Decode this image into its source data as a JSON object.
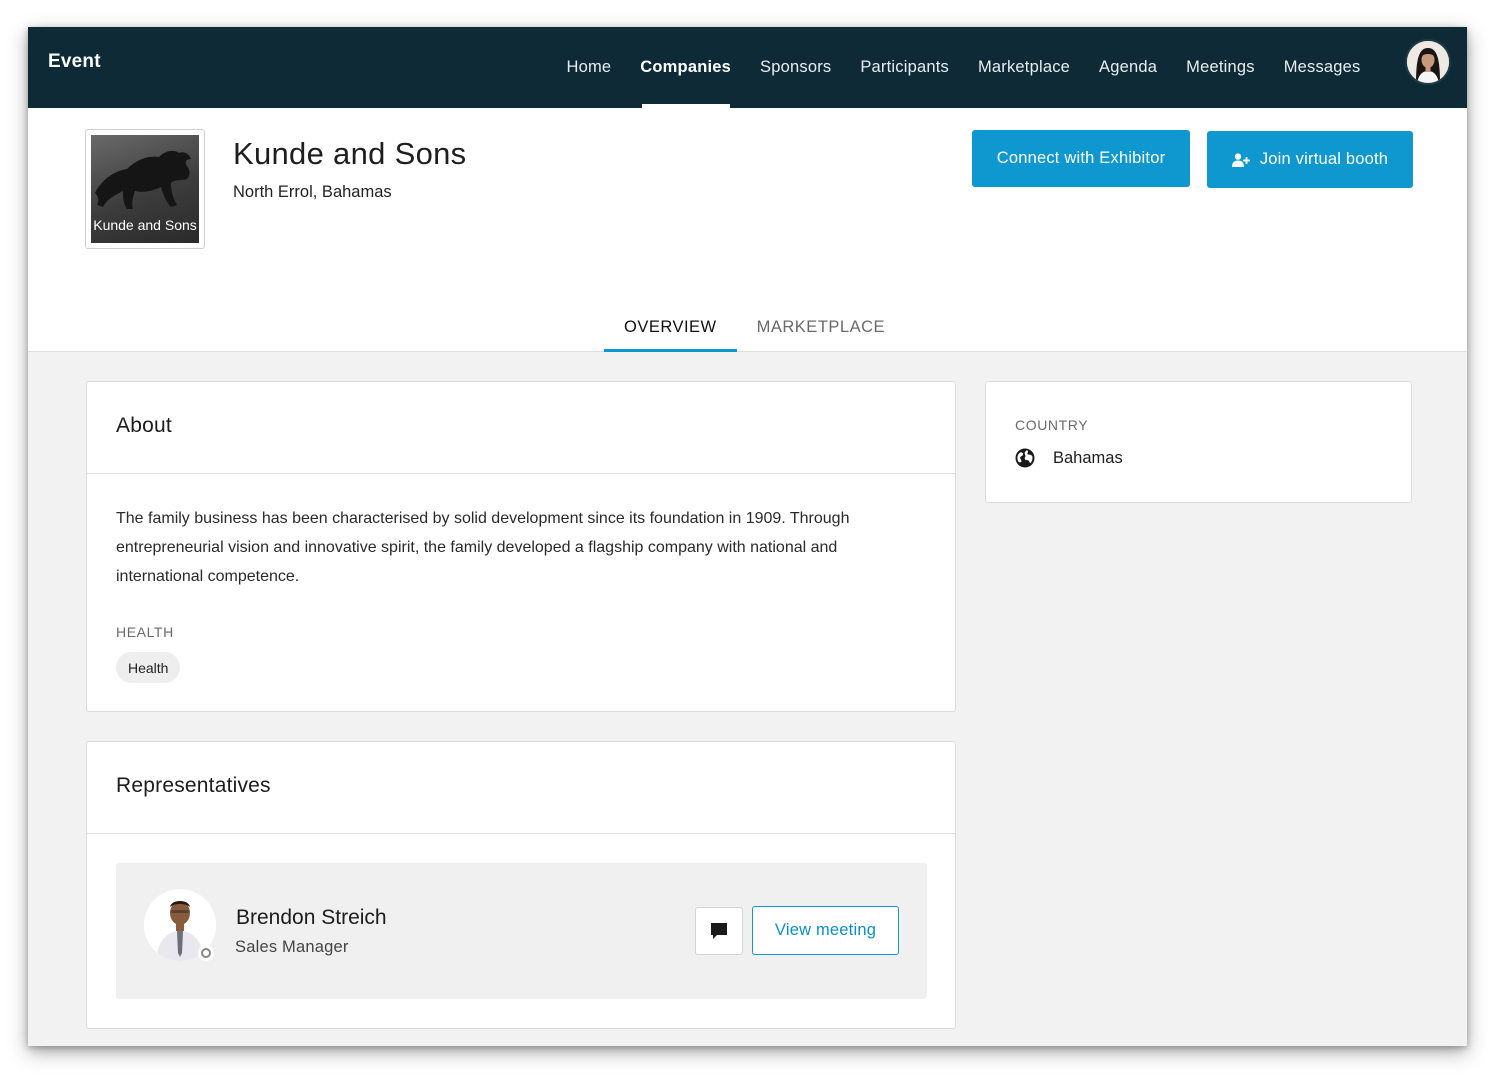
{
  "nav": {
    "brand": "Event",
    "links": [
      "Home",
      "Companies",
      "Sponsors",
      "Participants",
      "Marketplace",
      "Agenda",
      "Meetings",
      "Messages"
    ],
    "active": "Companies"
  },
  "company": {
    "logo_text": "Kunde and Sons",
    "name": "Kunde and Sons",
    "location": "North Errol, Bahamas"
  },
  "actions": {
    "connect_label": "Connect with Exhibitor",
    "join_label": "Join virtual booth"
  },
  "tabs": [
    {
      "label": "OVERVIEW",
      "active": true
    },
    {
      "label": "MARKETPLACE",
      "active": false
    }
  ],
  "about": {
    "title": "About",
    "description": "The family business has been characterised by solid development since its foundation in 1909. Through entrepreneurial vision and innovative spirit, the family developed a flagship company with national and international competence.",
    "category_label": "HEALTH",
    "tag": "Health"
  },
  "country": {
    "label": "COUNTRY",
    "value": "Bahamas"
  },
  "representatives": {
    "title": "Representatives",
    "items": [
      {
        "name": "Brendon Streich",
        "role": "Sales Manager",
        "view_label": "View meeting"
      }
    ]
  },
  "colors": {
    "nav_bg": "#0d2a36",
    "accent": "#0e98cf"
  }
}
